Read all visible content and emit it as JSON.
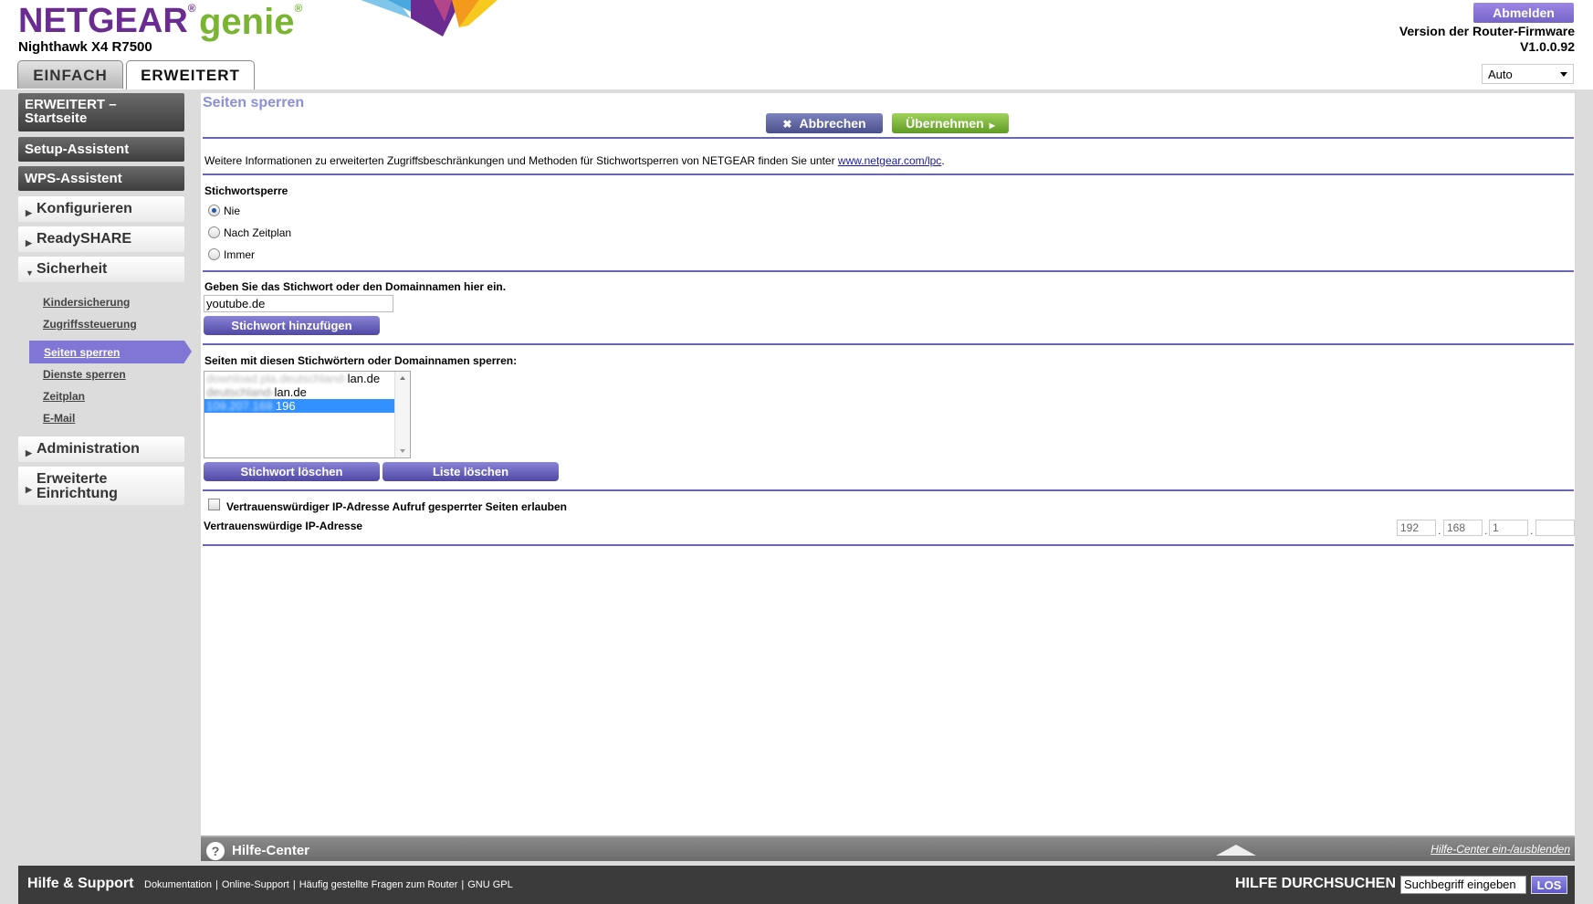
{
  "brand": {
    "name": "NETGEAR",
    "product": "genie",
    "model": "Nighthawk X4 R7500"
  },
  "tabs": [
    {
      "label": "EINFACH"
    },
    {
      "label": "ERWEITERT"
    }
  ],
  "header": {
    "logout_label": "Abmelden",
    "firmware_label": "Version der Router-Firmware",
    "firmware_version": "V1.0.0.92",
    "language_selected": "Auto"
  },
  "sidebar": {
    "home": "ERWEITERT – Startseite",
    "setup": "Setup-Assistent",
    "wps": "WPS-Assistent",
    "konfigurieren": "Konfigurieren",
    "readyshare": "ReadySHARE",
    "sicherheit": "Sicherheit",
    "sub_items": [
      "Kindersicherung",
      "Zugriffssteuerung",
      "Seiten sperren",
      "Dienste sperren",
      "Zeitplan",
      "E-Mail"
    ],
    "administration": "Administration",
    "erweiterte": "Erweiterte Einrichtung"
  },
  "main": {
    "title": "Seiten sperren",
    "cancel_label": "Abbrechen",
    "apply_label": "Übernehmen",
    "info_text": "Weitere Informationen zu erweiterten Zugriffsbeschränkungen und Methoden für Stichwortsperren von NETGEAR finden Sie unter ",
    "info_link": "www.netgear.com/lpc",
    "info_end": ".",
    "keyword_block_label": "Stichwortsperre",
    "radio_options": [
      "Nie",
      "Nach Zeitplan",
      "Immer"
    ],
    "radio_selected": "Nie",
    "enter_keyword_label": "Geben Sie das Stichwort oder den Domainnamen hier ein.",
    "keyword_value": "youtube.de",
    "add_keyword_label": "Stichwort hinzufügen",
    "blocked_list_label": "Seiten mit diesen Stichwörtern oder Domainnamen sperren:",
    "blocked_items": [
      {
        "hidden": "download.pla.deutschland-",
        "visible": "lan.de"
      },
      {
        "hidden": "deutschland-",
        "visible": "lan.de"
      },
      {
        "hidden": "109.207.169.",
        "visible": "196"
      }
    ],
    "selected_item_index": 2,
    "delete_keyword_label": "Stichwort löschen",
    "clear_list_label": "Liste löschen",
    "trusted_checkbox_label": "Vertrauenswürdiger IP-Adresse Aufruf gesperrter Seiten erlauben",
    "trusted_checked": false,
    "trusted_ip_label": "Vertrauenswürdige IP-Adresse",
    "trusted_ip": [
      "192",
      "168",
      "1",
      ""
    ]
  },
  "help": {
    "title": "Hilfe-Center",
    "toggle_label": "Hilfe-Center ein-/ausblenden"
  },
  "footer": {
    "title": "Hilfe & Support",
    "links": [
      "Dokumentation",
      "Online-Support",
      "Häufig gestellte Fragen zum Router",
      "GNU GPL"
    ],
    "search_label": "HILFE DURCHSUCHEN",
    "search_value": "Suchbegriff eingeben",
    "search_button": "LOS"
  },
  "colors": {
    "brand_purple": "#6b2c91",
    "genie_green": "#79b530",
    "accent": "#7f76d6",
    "rule": "#6b66b3"
  }
}
